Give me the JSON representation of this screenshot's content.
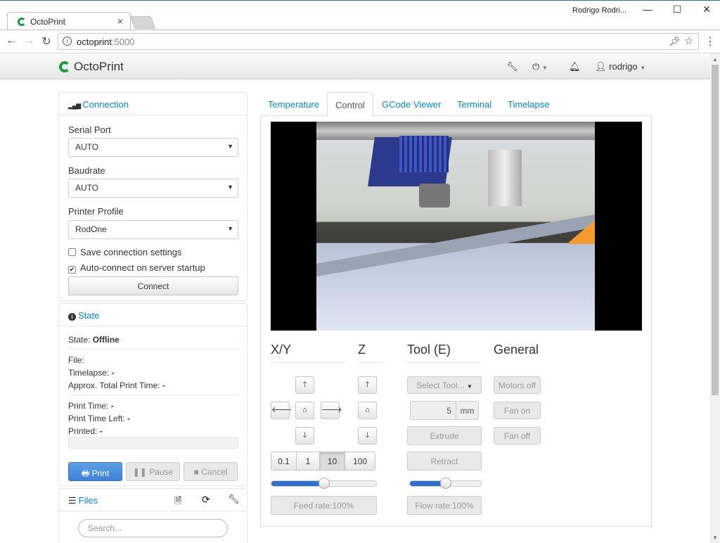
{
  "browser": {
    "tab_title": "OctoPrint",
    "tab_close": "×",
    "window_user": "Rodrigo Rodri...",
    "win_min": "—",
    "win_max": "☐",
    "win_close": "✕",
    "url_host": "octoprint",
    "url_port": ":5000",
    "info_icon": "i"
  },
  "navbar": {
    "brand": "OctoPrint",
    "user": "rodrigo"
  },
  "connection": {
    "title": "Connection",
    "serial_port_label": "Serial Port",
    "serial_port_value": "AUTO",
    "baudrate_label": "Baudrate",
    "baudrate_value": "AUTO",
    "profile_label": "Printer Profile",
    "profile_value": "RodOne",
    "save_settings_label": "Save connection settings",
    "save_settings_checked": false,
    "autoconnect_label": "Auto-connect on server startup",
    "autoconnect_checked": true,
    "connect_button": "Connect"
  },
  "state": {
    "title": "State",
    "state_label": "State:",
    "state_value": "Offline",
    "file_label": "File:",
    "timelapse_label": "Timelapse:",
    "timelapse_value": "-",
    "total_time_label": "Approx. Total Print Time:",
    "total_time_value": "-",
    "print_time_label": "Print Time:",
    "print_time_value": "-",
    "time_left_label": "Print Time Left:",
    "time_left_value": "-",
    "printed_label": "Printed:",
    "printed_value": "-",
    "print_button": "Print",
    "pause_button": "Pause",
    "cancel_button": "Cancel"
  },
  "files": {
    "title": "Files",
    "search_placeholder": "Search..."
  },
  "tabs": [
    "Temperature",
    "Control",
    "GCode Viewer",
    "Terminal",
    "Timelapse"
  ],
  "active_tab": "Control",
  "control": {
    "xy_title": "X/Y",
    "z_title": "Z",
    "tool_title": "Tool (E)",
    "general_title": "General",
    "step_sizes": [
      "0.1",
      "1",
      "10",
      "100"
    ],
    "active_step": "10",
    "feed_rate_button": "Feed rate:100%",
    "feed_rate_slider": 0.5,
    "select_tool_button": "Select Tool...",
    "extrude_amount": "5",
    "extrude_unit": "mm",
    "extrude_button": "Extrude",
    "retract_button": "Retract",
    "flow_rate_button": "Flow rate:100%",
    "flow_rate_slider": 0.5,
    "motors_off_button": "Motors off",
    "fan_on_button": "Fan on",
    "fan_off_button": "Fan off"
  }
}
